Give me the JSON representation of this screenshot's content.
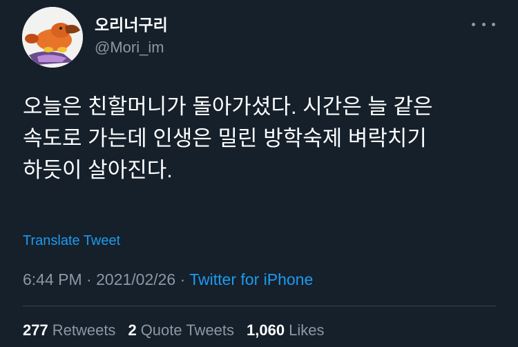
{
  "author": {
    "display_name": "오리너구리",
    "handle": "@Mori_im",
    "avatar": "platypus-avatar"
  },
  "tweet": {
    "lines": [
      "오늘은 친할머니가 돌아가셨다. 시간은 늘 같은",
      "속도로 가는데 인생은 밀린 방학숙제 벼락치기",
      "하듯이 살아진다."
    ],
    "translate_label": "Translate Tweet"
  },
  "meta": {
    "time": "6:44 PM",
    "separator": "·",
    "date": "2021/02/26",
    "source": "Twitter for iPhone"
  },
  "stats": {
    "retweets_count": "277",
    "retweets_label": "Retweets",
    "quotes_count": "2",
    "quotes_label": "Quote Tweets",
    "likes_count": "1,060",
    "likes_label": "Likes"
  },
  "icons": {
    "more": "more-horizontal-icon"
  },
  "colors": {
    "background": "#15202b",
    "link": "#1d9bf0",
    "secondary_text": "#8b98a5",
    "divider": "#38444d"
  }
}
